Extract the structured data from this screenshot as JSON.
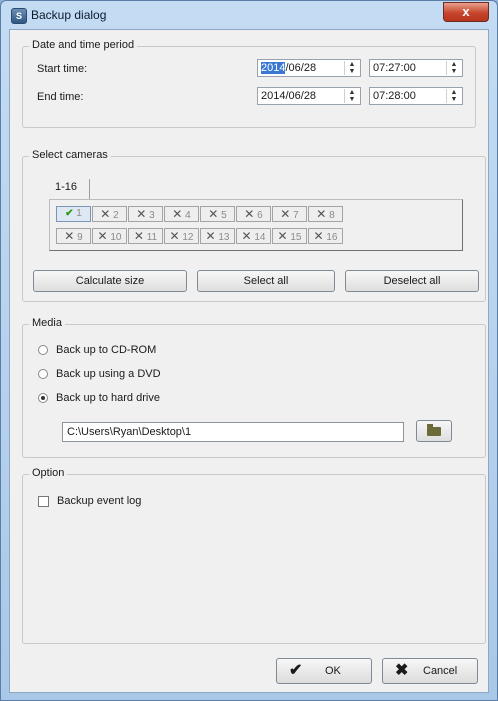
{
  "window": {
    "title": "Backup dialog",
    "close_glyph": "x"
  },
  "date_time": {
    "group_title": "Date and time period",
    "start_label": "Start time:",
    "end_label": "End time:",
    "start_date_highlight": "2014",
    "start_date_rest": "/06/28",
    "start_time": "07:27:00",
    "end_date": "2014/06/28",
    "end_time": "07:28:00"
  },
  "cameras": {
    "group_title": "Select cameras",
    "tab_label": "1-16",
    "row1": [
      "1",
      "2",
      "3",
      "4",
      "5",
      "6",
      "7",
      "8"
    ],
    "row2": [
      "9",
      "10",
      "11",
      "12",
      "13",
      "14",
      "15",
      "16"
    ],
    "selected": [
      "1"
    ],
    "calc_button": "Calculate size",
    "select_all_button": "Select all",
    "deselect_all_button": "Deselect all"
  },
  "media": {
    "group_title": "Media",
    "options": [
      "Back up to CD-ROM",
      "Back up using a DVD",
      "Back up to hard drive"
    ],
    "selected": "Back up to hard drive",
    "path_value": "C:\\Users\\Ryan\\Desktop\\1"
  },
  "option": {
    "group_title": "Option",
    "backup_event_log": "Backup event log",
    "backup_event_log_checked": false
  },
  "footer": {
    "ok_label": "OK",
    "cancel_label": "Cancel"
  },
  "colors": {
    "title_accent": "#b8361f",
    "selected_check": "#2b9c1b",
    "date_highlight": "#3a78d4"
  },
  "icons": {
    "app": "app-icon",
    "close": "close-icon",
    "folder": "folder-icon",
    "ok": "check-icon",
    "cancel": "x-icon"
  }
}
